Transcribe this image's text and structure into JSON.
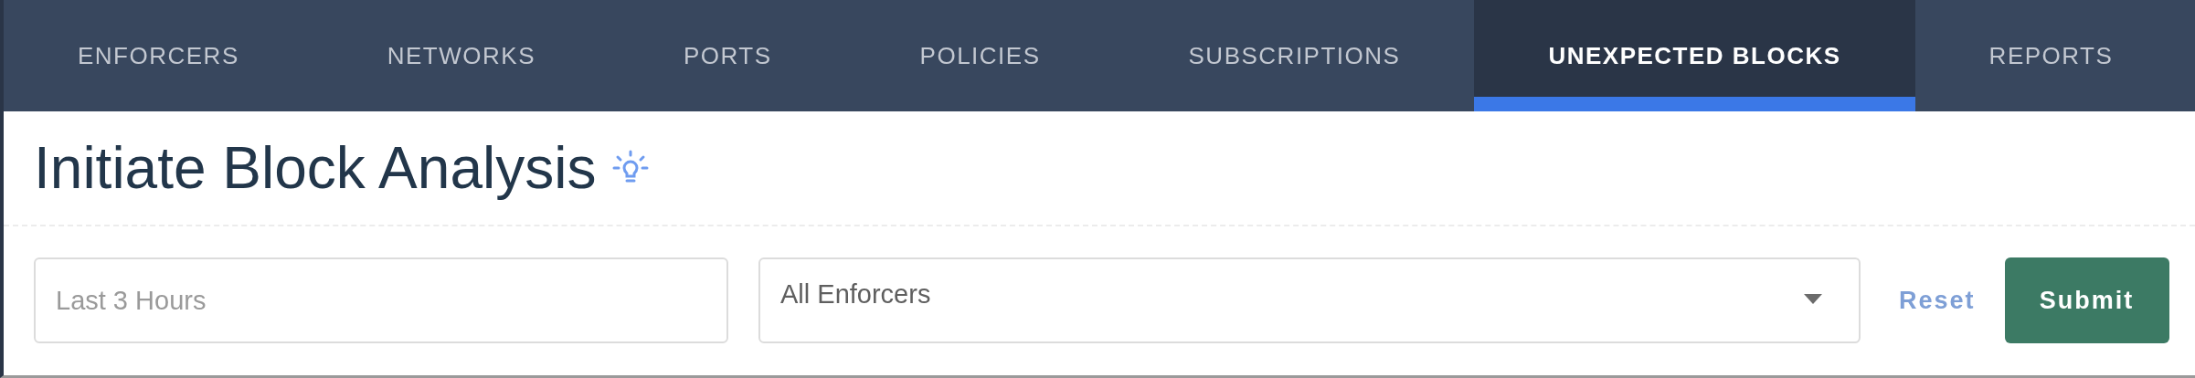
{
  "tabs": [
    {
      "label": "ENFORCERS",
      "selected": false
    },
    {
      "label": "NETWORKS",
      "selected": false
    },
    {
      "label": "PORTS",
      "selected": false
    },
    {
      "label": "POLICIES",
      "selected": false
    },
    {
      "label": "SUBSCRIPTIONS",
      "selected": false
    },
    {
      "label": "UNEXPECTED BLOCKS",
      "selected": true
    },
    {
      "label": "REPORTS",
      "selected": false
    }
  ],
  "page_title": "Initiate Block Analysis",
  "time_range": {
    "placeholder": "Last 3 Hours"
  },
  "enforcer_select": {
    "value": "All Enforcers"
  },
  "buttons": [
    {
      "kind": "link",
      "label": "Reset"
    },
    {
      "kind": "primary",
      "label": "Submit"
    }
  ]
}
